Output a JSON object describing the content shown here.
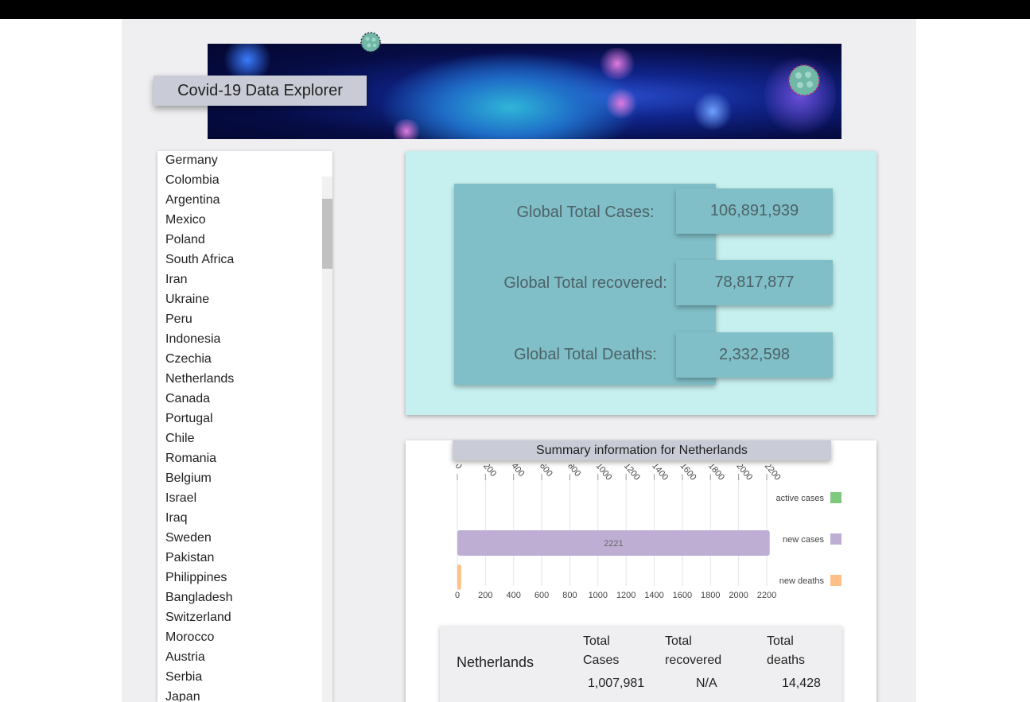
{
  "header": {
    "title": "Covid-19 Data Explorer"
  },
  "countries": [
    "Germany",
    "Colombia",
    "Argentina",
    "Mexico",
    "Poland",
    "South Africa",
    "Iran",
    "Ukraine",
    "Peru",
    "Indonesia",
    "Czechia",
    "Netherlands",
    "Canada",
    "Portugal",
    "Chile",
    "Romania",
    "Belgium",
    "Israel",
    "Iraq",
    "Sweden",
    "Pakistan",
    "Philippines",
    "Bangladesh",
    "Switzerland",
    "Morocco",
    "Austria",
    "Serbia",
    "Japan"
  ],
  "global": {
    "cases_label": "Global Total Cases:",
    "cases_value": "106,891,939",
    "recovered_label": "Global Total recovered:",
    "recovered_value": "78,817,877",
    "deaths_label": "Global Total Deaths:",
    "deaths_value": "2,332,598"
  },
  "summary": {
    "title": "Summary information for Netherlands",
    "country": "Netherlands",
    "col_cases": "Total Cases",
    "col_recovered": "Total recovered",
    "col_deaths": "Total deaths",
    "cases": "1,007,981",
    "recovered": "N/A",
    "deaths": "14,428"
  },
  "chart_data": {
    "type": "bar",
    "orientation": "horizontal",
    "xlim": [
      0,
      2200
    ],
    "ticks": [
      0,
      200,
      400,
      600,
      800,
      1000,
      1200,
      1400,
      1600,
      1800,
      2000,
      2200
    ],
    "series": [
      {
        "name": "active cases",
        "value": 0,
        "color": "#7fc97f"
      },
      {
        "name": "new cases",
        "value": 2221,
        "color": "#beaed4",
        "label": "2221"
      },
      {
        "name": "new deaths",
        "value": 27,
        "color": "#fdc086"
      }
    ],
    "legend_position": "right"
  }
}
